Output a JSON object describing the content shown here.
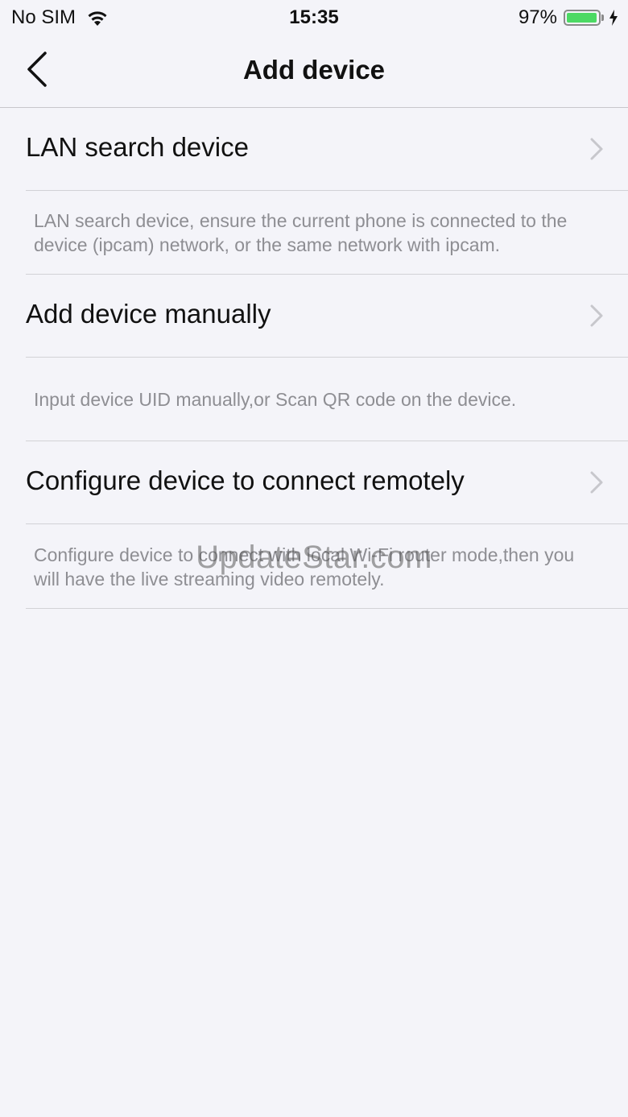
{
  "status_bar": {
    "carrier": "No SIM",
    "time": "15:35",
    "battery_percent": "97%",
    "battery_level": 0.97,
    "battery_color": "#4cd964"
  },
  "nav": {
    "title": "Add device",
    "back_icon": "chevron-left-icon"
  },
  "options": [
    {
      "label": "LAN search device",
      "description": "LAN search device, ensure the current phone is connected to the device (ipcam) network, or the same network with ipcam."
    },
    {
      "label": "Add device manually",
      "description": "Input device UID manually,or Scan QR code on the device."
    },
    {
      "label": "Configure device to connect remotely",
      "description": "Configure device to connect with local Wi-Fi router mode,then you will have the live streaming video remotely."
    }
  ],
  "watermark": "UpdateStar.com"
}
